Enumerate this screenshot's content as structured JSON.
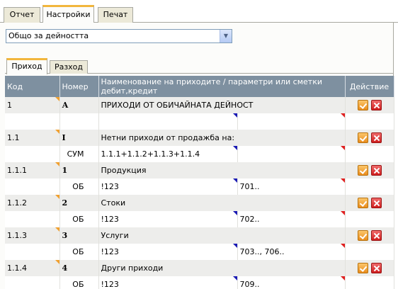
{
  "top_tabs": [
    "Отчет",
    "Настройки",
    "Печат"
  ],
  "select": {
    "value": "Общо за дейността"
  },
  "sub_tabs": [
    "Приход",
    "Разход"
  ],
  "table": {
    "headers": {
      "code": "Код",
      "number": "Номер",
      "name": "Наименование на приходите / параметри или сметки дебит,кредит",
      "action": "Действие"
    },
    "rows": [
      {
        "code": "1",
        "number": "А",
        "name": "ПРИХОДИ ОТ ОБИЧАЙНАТА ДЕЙНОСТ",
        "sub_label": "",
        "debit": "",
        "credit": ""
      },
      {
        "code": "1.1",
        "number": "I",
        "name": "Нетни приходи от продажба на:",
        "sub_label": "СУМ",
        "debit": "1.1.1+1.1.2+1.1.3+1.1.4",
        "credit": ""
      },
      {
        "code": "1.1.1",
        "number": "1",
        "name": "Продукция",
        "sub_label": "ОБ",
        "debit": "!123",
        "credit": "701.."
      },
      {
        "code": "1.1.2",
        "number": "2",
        "name": "Стоки",
        "sub_label": "ОБ",
        "debit": "!123",
        "credit": "702.."
      },
      {
        "code": "1.1.3",
        "number": "3",
        "name": "Услуги",
        "sub_label": "ОБ",
        "debit": "!123",
        "credit": "703.., 706.."
      },
      {
        "code": "1.1.4",
        "number": "4",
        "name": "Други приходи",
        "sub_label": "ОБ",
        "debit": "!123",
        "credit": "709.."
      }
    ]
  },
  "colors": {
    "header_bg": "#7e90a0",
    "row_hdr_bg": "#ededeb",
    "tab_accent": "#f2b63c",
    "edit": "#f0a030",
    "delete": "#e02020",
    "marker_blue": "#1a1ab4"
  },
  "icons": {
    "edit": "checkmark-icon",
    "delete": "close-icon",
    "dropdown": "chevron-down-icon"
  }
}
